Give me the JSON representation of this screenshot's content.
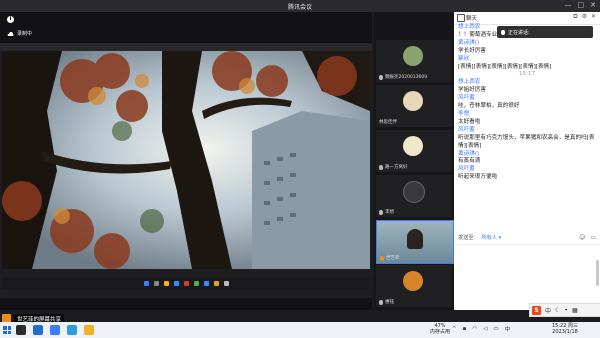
{
  "window": {
    "title": "腾讯会议",
    "controls": [
      "—",
      "□",
      "✕"
    ]
  },
  "meeting": {
    "info_icon": "i",
    "recording_label": "录制中",
    "share_label": "世艺菲的屏幕共享"
  },
  "participants": [
    {
      "name": "魏振宪2020013609",
      "avatar_color": "#8aa36a",
      "mic": "muted"
    },
    {
      "name": "林思佳伴",
      "avatar_color": "#e9d8b8",
      "mic": "muted"
    },
    {
      "name": "路一方窝好",
      "avatar_color": "#efe7c8",
      "mic": "muted"
    },
    {
      "name": "李想",
      "avatar_color": "#3a3a3c",
      "mic": "muted"
    },
    {
      "name": "世艺菲",
      "avatar_color": "#6b8a9a",
      "mic": "speaking"
    },
    {
      "name": "惠钰",
      "avatar_color": "#d6852a",
      "mic": "muted"
    }
  ],
  "chat": {
    "title": "聊天",
    "speaking_banner": "正在讲话:",
    "messages": [
      {
        "sender": "想上西农",
        "text": "！！葡萄酒专业！！！"
      },
      {
        "sender": "黄诗琪()",
        "text": "学长好厉害"
      },
      {
        "sender": "蔡欣",
        "text": "[表情][表情][表情][表情][表情][表情]"
      },
      {
        "timestamp": "15:17"
      },
      {
        "sender": "想上西农",
        "text": "学姐好厉害"
      },
      {
        "sender": "风吓蓄",
        "text": "哇，苍林翠柏，真的很好"
      },
      {
        "sender": "李想",
        "text": "太好看啦"
      },
      {
        "sender": "风吓蓄",
        "text": "听说那里有巧克力馒头，苹果猪和农高会，是真的吗[表情][表情]"
      },
      {
        "sender": "黄诗琪()",
        "text": "有蒸有滴"
      },
      {
        "sender": "风吓蓄",
        "text": "听起来很万便啦"
      }
    ],
    "send_to_label": "发送至:",
    "send_to_value": "所有人 ▾"
  },
  "taskbar": {
    "memory_pct": "47%",
    "memory_label": "内存占用",
    "time": "15:22 周三",
    "date": "2023/1/18",
    "ime_label": "中"
  },
  "colors": {
    "accent_blue": "#3a7cff",
    "share_orange": "#f08c1a"
  }
}
